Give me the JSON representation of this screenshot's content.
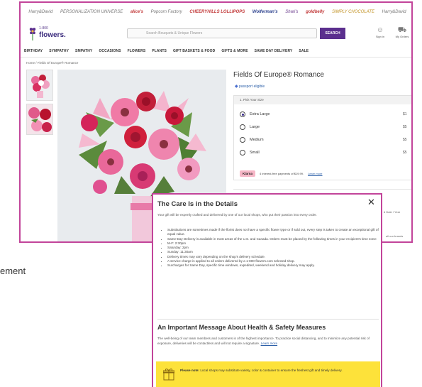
{
  "brands": [
    "Harry&David",
    "PERSONALIZATION UNIVERSE",
    "alice's",
    "Popcorn Factory",
    "CHEERYHILLS LOLLIPOPS",
    "Wolferman's",
    "Shari's",
    "goldbelly",
    "SIMPLY CHOCOLATE",
    "Harry&David"
  ],
  "site": {
    "logo_small": "1-800",
    "logo_big": "flowers.",
    "search_placeholder": "Search Bouquets & Unique Flowers",
    "search_button": "SEARCH",
    "sign_in": "Sign in",
    "my_orders": "My Orders"
  },
  "nav": [
    "BIRTHDAY",
    "SYMPATHY",
    "SMPATHY",
    "OCCASIONS",
    "FLOWERS",
    "PLANTS",
    "GIFT BASKETS & FOOD",
    "GIFTS & MORE",
    "SAME DAY DELIVERY",
    "SALE"
  ],
  "breadcrumb": "Home / Fields Of Europe® Romance",
  "product": {
    "title": "Fields Of Europe® Romance",
    "passport": "passport eligible",
    "size_header": "1. Pick Your Size",
    "sizes": [
      {
        "label": "Extra Large",
        "price": "$1",
        "selected": true
      },
      {
        "label": "Large",
        "price": "$5",
        "selected": false
      },
      {
        "label": "Medium",
        "price": "$5",
        "selected": false
      },
      {
        "label": "Small",
        "price": "$5",
        "selected": false
      }
    ],
    "klarna_badge": "Klarna",
    "klarna_text": "4 interest-free payments of $19.99.",
    "klarna_link": "Learn more",
    "right_text1": "d Date / Year",
    "right_text2": "all our brands"
  },
  "replacement_text": "ement",
  "modal": {
    "title": "The Care Is in the Details",
    "intro": "Your gift will be expertly crafted and delivered by one of our local shops, who put their passion into every order.",
    "bullets": [
      "Substitutions are sometimes made if the florist does not have a specific flower type or if sold out, every step is taken to create an exceptional gift of equal value.",
      "Same-Day Delivery is available in most areas of the U.S. and Canada. Orders must be placed by the following times in your recipient's time zone:",
      "M-F: 2:30pm",
      "Saturday: 2pm",
      "Sunday: 11:30am",
      "Delivery times may vary depending on the shop's delivery schedule.",
      "A service charge is applied to all orders delivered by a 1-800-flowers.com selected shop.",
      "Surcharges for Same Day, specific time windows, expedited, weekend and holiday delivery may apply."
    ],
    "section2_title": "An Important Message About Health & Safety Measures",
    "section2_text": "The well-being of our team members and customers is of the highest importance. To practice social distancing, and to minimize any potential risk of exposure, deliveries will be contactless and will not require a signature.",
    "section2_link": "Learn more",
    "notice_bold": "Please note:",
    "notice_text": "Local shops may substitute variety, color & container to ensure the freshest gift and timely delivery."
  },
  "colors": {
    "frame_border": "#c2449a",
    "search_button": "#5b2f8e",
    "notice_bg": "#fde23a",
    "klarna_badge": "#f7b7c7"
  }
}
